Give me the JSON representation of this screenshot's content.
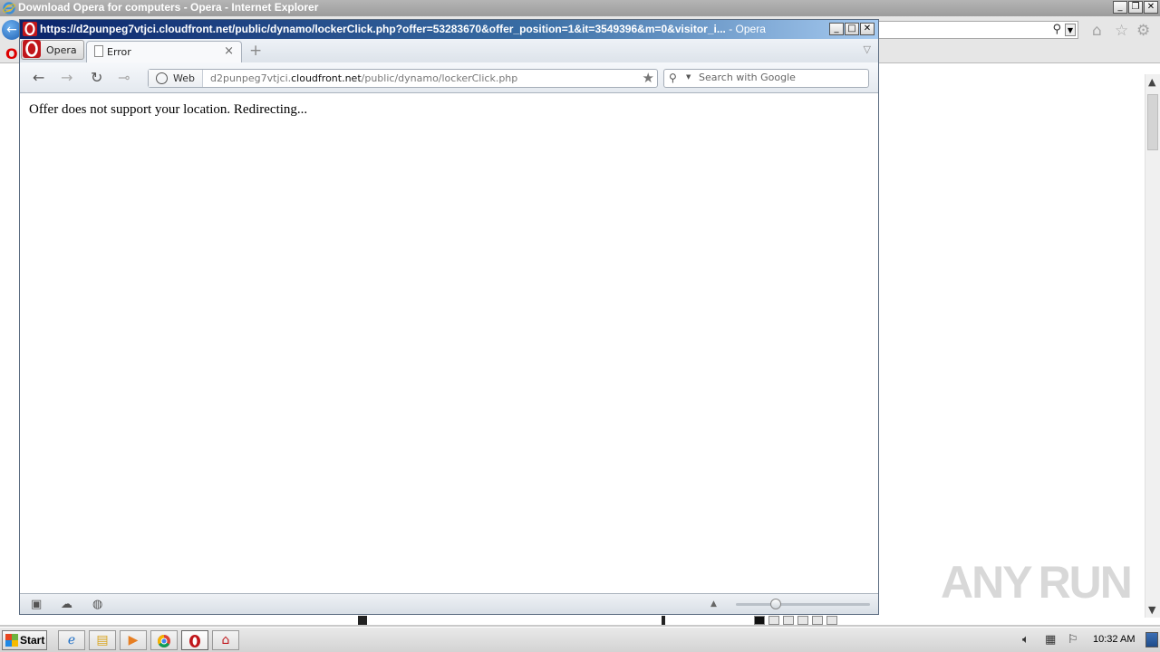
{
  "ie": {
    "window_title": "Download Opera for computers - Opera - Internet Explorer",
    "tabstrip_icon_letter": "O"
  },
  "opera": {
    "window_title": "https://d2punpeg7vtjci.cloudfront.net/public/dynamo/lockerClick.php?offer=53283670&offer_position=1&it=3549396&m=0&visitor_i...",
    "window_title_suffix": " - Opera",
    "menu_label": "Opera",
    "tab_title": "Error",
    "address_badge": "Web",
    "address_url_prefix": "d2punpeg7vtjci.",
    "address_url_domain": "cloudfront.net",
    "address_url_path": "/public/dynamo/lockerClick.php",
    "search_placeholder": "Search with Google",
    "page_message": "Offer does not support your location. Redirecting...",
    "zoom_level": 0.28
  },
  "watermark": {
    "left": "ANY",
    "right": "RUN"
  },
  "taskbar": {
    "start_label": "Start",
    "clock": "10:32 AM"
  }
}
